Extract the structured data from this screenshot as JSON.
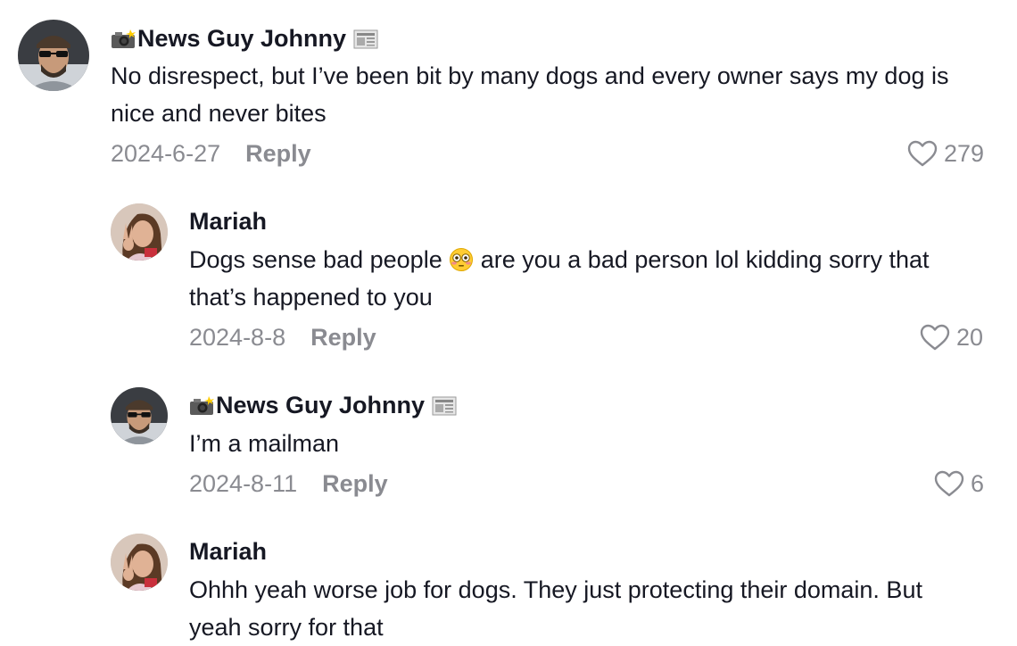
{
  "comments": [
    {
      "username": "News Guy Johnny",
      "text": "No disrespect, but I’ve been bit by many dogs and every owner says my dog is nice and never bites",
      "date": "2024-6-27",
      "reply_label": "Reply",
      "likes": "279"
    },
    {
      "username": "Mariah",
      "text_before_emoji": "Dogs sense bad people ",
      "emoji": "flushed-face-emoji",
      "text_after_emoji": " are you a bad person lol kidding sorry that that’s happened to you",
      "date": "2024-8-8",
      "reply_label": "Reply",
      "likes": "20"
    },
    {
      "username": "News Guy Johnny",
      "text": "I’m a mailman",
      "date": "2024-8-11",
      "reply_label": "Reply",
      "likes": "6"
    },
    {
      "username": "Mariah",
      "text": "Ohhh yeah worse job for dogs. They just protecting their domain. But yeah sorry for that"
    }
  ],
  "colors": {
    "text": "#161823",
    "meta": "#8a8b91",
    "background": "#ffffff"
  },
  "icons": {
    "like": "heart-outline-icon",
    "camera": "camera-flash-emoji",
    "newspaper": "newspaper-emoji"
  }
}
